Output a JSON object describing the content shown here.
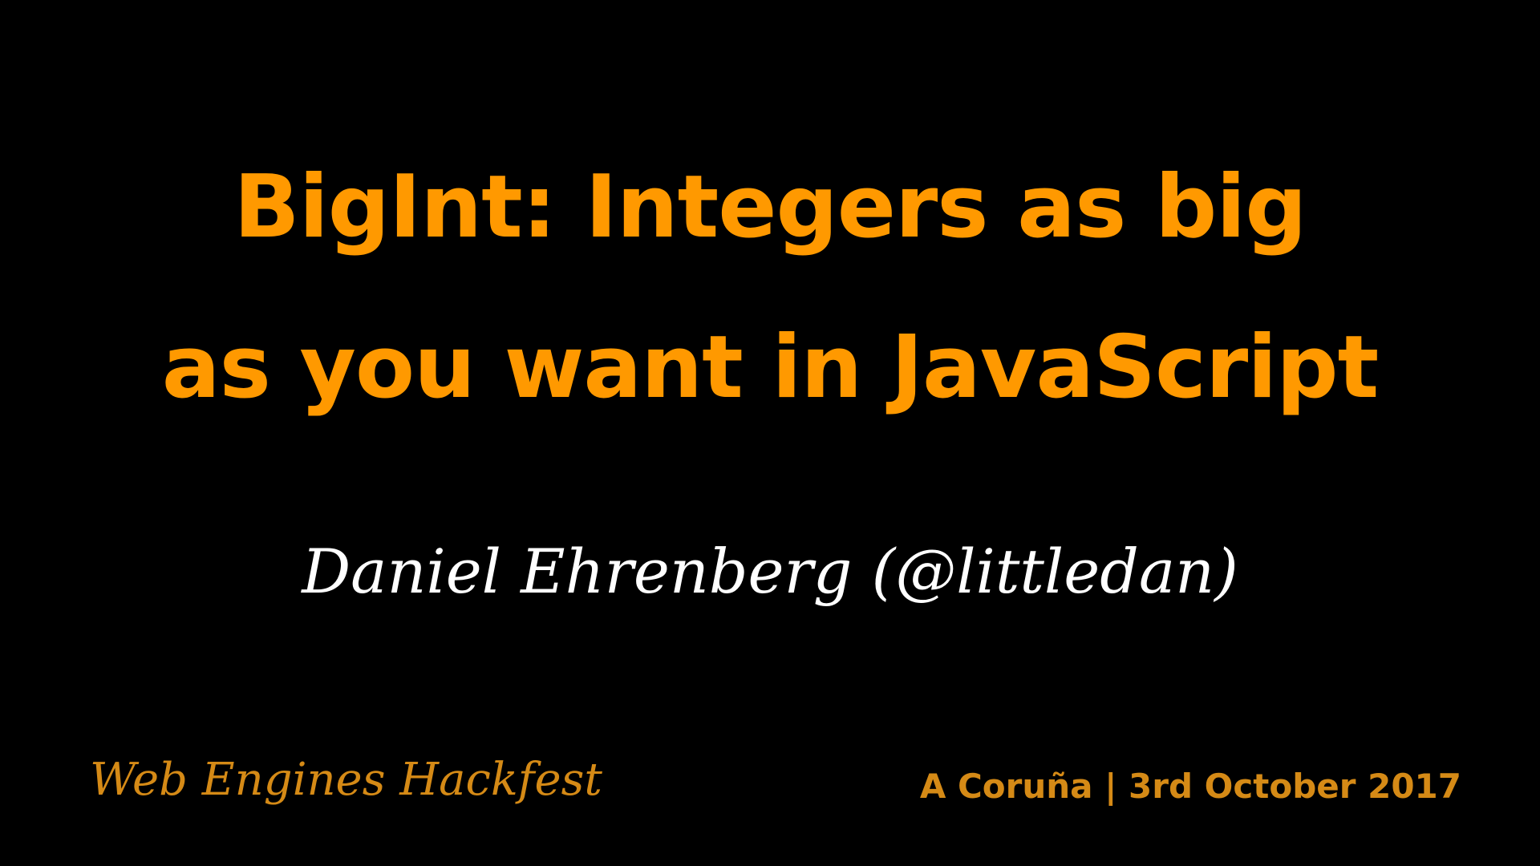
{
  "slide": {
    "title_lines": [
      "BigInt: Integers as big",
      "as you want in JavaScript"
    ],
    "author": "Daniel Ehrenberg (@littledan)",
    "event": "Web Engines Hackfest",
    "location_date": "A Coruña | 3rd October 2017"
  },
  "colors": {
    "background": "#000000",
    "title": "#ff9900",
    "author": "#ffffff",
    "footer": "#d58a16"
  }
}
